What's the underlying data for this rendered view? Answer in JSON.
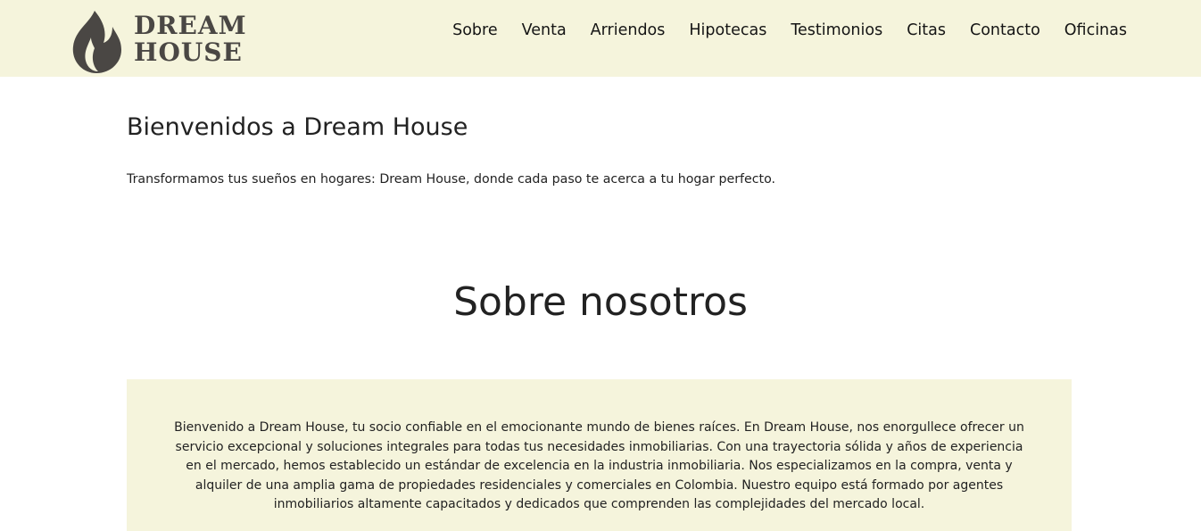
{
  "header": {
    "logo": {
      "line1": "DREAM",
      "line2": "HOUSE",
      "icon": "flame-icon",
      "color": "#4a4744"
    },
    "background": "#f5f4dc",
    "nav": [
      {
        "label": "Sobre"
      },
      {
        "label": "Venta"
      },
      {
        "label": "Arriendos"
      },
      {
        "label": "Hipotecas"
      },
      {
        "label": "Testimonios"
      },
      {
        "label": "Citas"
      },
      {
        "label": "Contacto"
      },
      {
        "label": "Oficinas"
      }
    ]
  },
  "welcome": {
    "title": "Bienvenidos a Dream House",
    "text": "Transformamos tus sueños en hogares: Dream House, donde cada paso te acerca a tu hogar perfecto."
  },
  "about": {
    "title": "Sobre nosotros",
    "text": "Bienvenido a Dream House, tu socio confiable en el emocionante mundo de bienes raíces. En Dream House, nos enorgullece ofrecer un servicio excepcional y soluciones integrales para todas tus necesidades inmobiliarias. Con una trayectoria sólida y años de experiencia en el mercado, hemos establecido un estándar de excelencia en la industria inmobiliaria. Nos especializamos en la compra, venta y alquiler de una amplia gama de propiedades residenciales y comerciales en Colombia. Nuestro equipo está formado por agentes inmobiliarios altamente capacitados y dedicados que comprenden las complejidades del mercado local."
  }
}
